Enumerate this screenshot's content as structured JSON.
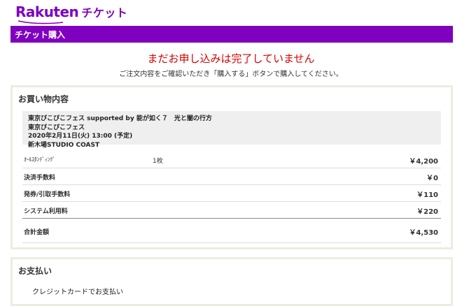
{
  "header": {
    "brand": "Rakuten",
    "product": "チケット"
  },
  "title_bar": {
    "title": "チケット購入"
  },
  "notice": {
    "warning": "まだお申し込みは完了していません",
    "instruction": "ご注文内容をご確認いただき「購入する」ボタンで購入してください。"
  },
  "purchase": {
    "heading": "お買い物内容",
    "event": {
      "name": "東京ぴこぴこフェス supported by 能が如く７　光と闇の行方",
      "subtitle": "東京ぴこぴこフェス",
      "datetime": "2020年2月11日(火) 13:00 (予定)",
      "venue": "新木場STUDIO COAST"
    },
    "items": [
      {
        "label": "ｵｰﾙｽﾀﾝﾃﾞｨﾝｸﾞ",
        "qty": "1枚",
        "amount": "￥4,200"
      },
      {
        "label": "決済手数料",
        "qty": "",
        "amount": "￥0"
      },
      {
        "label": "発券/引取手数料",
        "qty": "",
        "amount": "￥110"
      },
      {
        "label": "システム利用料",
        "qty": "",
        "amount": "￥220"
      }
    ],
    "total": {
      "label": "合計金額",
      "amount": "￥4,530"
    }
  },
  "payment": {
    "heading": "お支払い",
    "method": "クレジットカードでお支払い"
  },
  "colors": {
    "brand_purple": "#7f00bf",
    "warning_red": "#d90000"
  }
}
